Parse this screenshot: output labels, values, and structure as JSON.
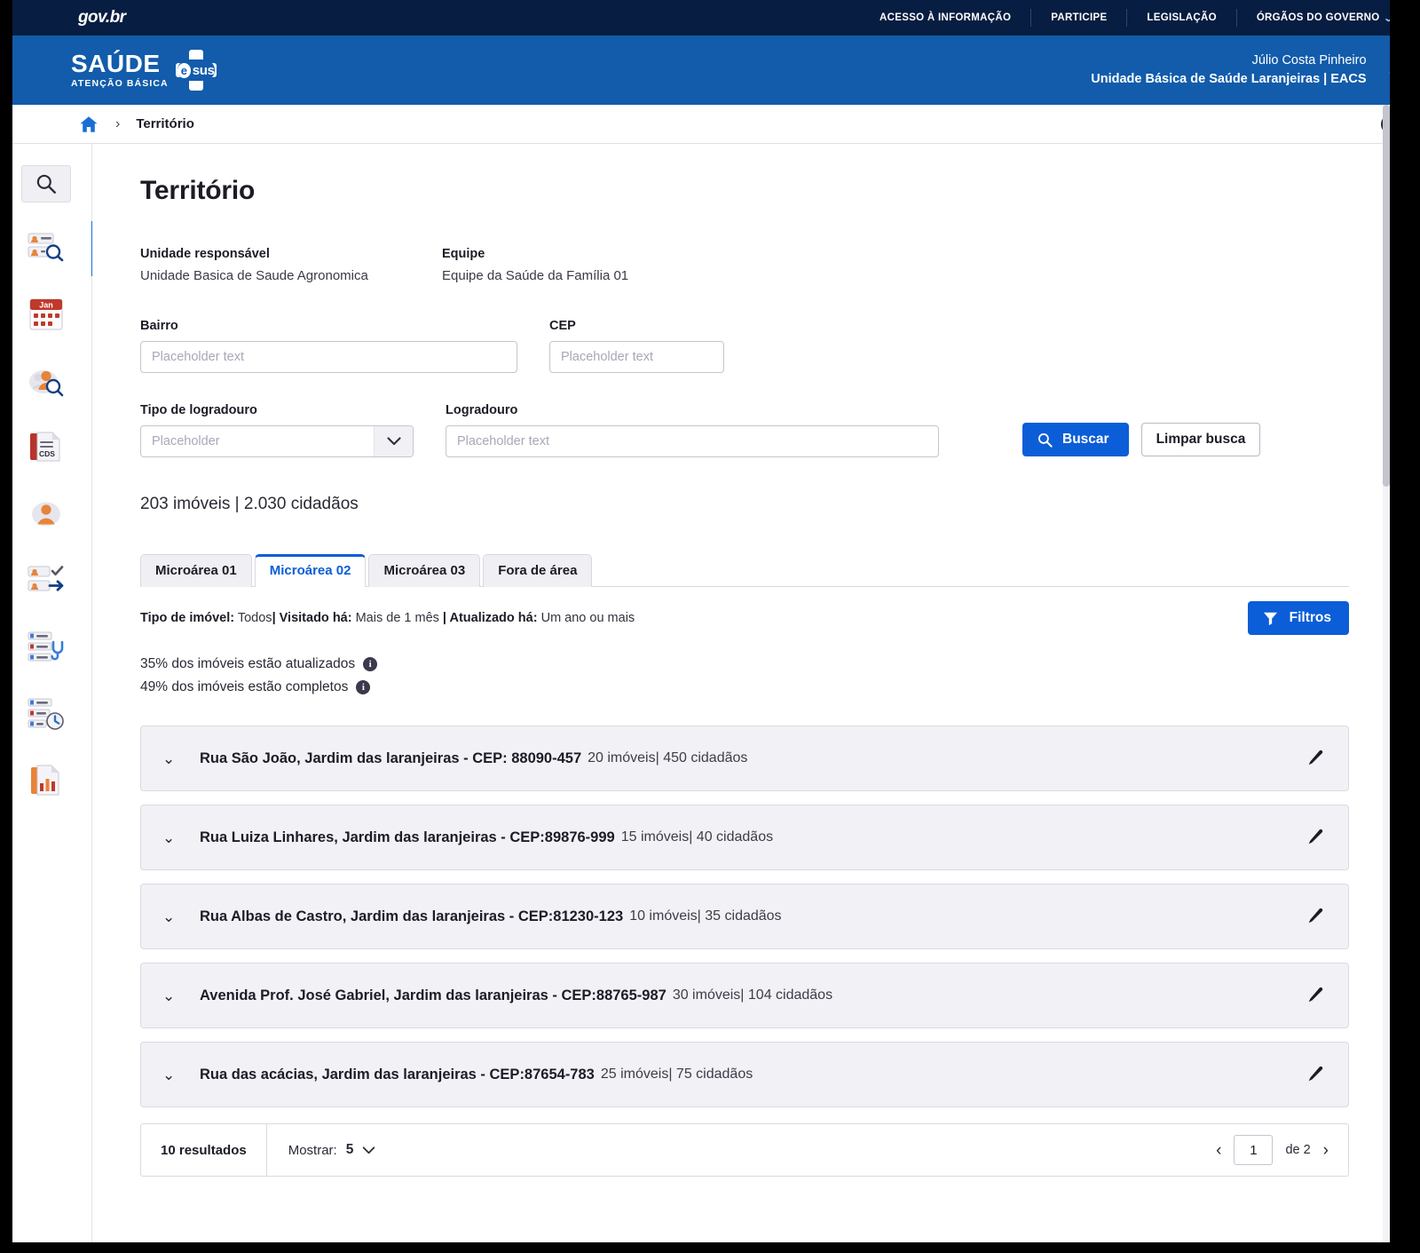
{
  "govbar": {
    "logo": "gov.br",
    "nav": [
      {
        "label": "ACESSO À INFORMAÇÃO"
      },
      {
        "label": "PARTICIPE"
      },
      {
        "label": "LEGISLAÇÃO"
      },
      {
        "label": "ÓRGÃOS DO GOVERNO"
      }
    ]
  },
  "brand": {
    "title": "SAÚDE",
    "subtitle": "ATENÇÃO BÁSICA",
    "esus_e": "e",
    "esus_sus": "sus",
    "user_name": "Júlio Costa Pinheiro",
    "user_unit": "Unidade Básica de Saúde Laranjeiras | EACS"
  },
  "breadcrumb": {
    "home_icon": "home-icon",
    "separator": "›",
    "current": "Território",
    "contrast_icon": "contrast-icon"
  },
  "sidebar": {
    "items": [
      {
        "icon": "search-icon",
        "name": "sidebar-item-search"
      },
      {
        "icon": "citizen-search-icon",
        "name": "sidebar-item-cidadao"
      },
      {
        "icon": "calendar-icon",
        "name": "sidebar-item-agenda",
        "month": "Jan"
      },
      {
        "icon": "group-search-icon",
        "name": "sidebar-item-grupos"
      },
      {
        "icon": "cds-document-icon",
        "name": "sidebar-item-cds",
        "badge": "CDS"
      },
      {
        "icon": "user-avatar-icon",
        "name": "sidebar-item-perfil"
      },
      {
        "icon": "checkin-transfer-icon",
        "name": "sidebar-item-atendimento"
      },
      {
        "icon": "list-stethoscope-icon",
        "name": "sidebar-item-lista-atendimento"
      },
      {
        "icon": "list-clock-icon",
        "name": "sidebar-item-lista-espera"
      },
      {
        "icon": "report-chart-icon",
        "name": "sidebar-item-relatorios"
      }
    ]
  },
  "page": {
    "title": "Território"
  },
  "info": {
    "unit_label": "Unidade responsável",
    "unit_value": "Unidade Basica de Saude Agronomica",
    "team_label": "Equipe",
    "team_value": "Equipe da Saúde da Família 01"
  },
  "form": {
    "bairro_label": "Bairro",
    "bairro_placeholder": "Placeholder text",
    "bairro_value": "",
    "cep_label": "CEP",
    "cep_placeholder": "Placeholder text",
    "cep_value": "",
    "tipo_label": "Tipo de logradouro",
    "tipo_placeholder": "Placeholder",
    "tipo_value": "Placeholder",
    "logradouro_label": "Logradouro",
    "logradouro_placeholder": "Placeholder text",
    "logradouro_value": "",
    "buscar_label": "Buscar",
    "limpar_label": "Limpar busca"
  },
  "counts": {
    "text": "203 imóveis  | 2.030 cidadãos"
  },
  "tabs": [
    {
      "label": "Microárea 01",
      "active": false
    },
    {
      "label": "Microárea 02",
      "active": true
    },
    {
      "label": "Microárea 03",
      "active": false
    },
    {
      "label": "Fora de área",
      "active": false
    }
  ],
  "filters": {
    "tipo_key": "Tipo de imóvel:",
    "tipo_val": " Todos",
    "visitado_key": "| Visitado há:",
    "visitado_val": " Mais de 1 mês ",
    "atualizado_key": "| Atualizado há:",
    "atualizado_val": " Um ano ou mais",
    "button_label": "Filtros",
    "button_icon": "filter-funnel-icon"
  },
  "stats": [
    {
      "text": "35% dos imóveis estão atualizados",
      "info": "i"
    },
    {
      "text": "49% dos imóveis estão completos",
      "info": "i"
    }
  ],
  "streets": [
    {
      "chevron": "⌄",
      "name": "Rua São João, Jardim das laranjeiras - CEP: 88090-457",
      "meta": "20 imóveis| 450 cidadãos",
      "edit_icon": "pencil-icon"
    },
    {
      "chevron": "⌄",
      "name": "Rua Luiza Linhares, Jardim das laranjeiras - CEP:89876-999",
      "meta": "15 imóveis| 40 cidadãos",
      "edit_icon": "pencil-icon"
    },
    {
      "chevron": "⌄",
      "name": "Rua Albas de Castro, Jardim das laranjeiras - CEP:81230-123",
      "meta": "10 imóveis| 35 cidadãos",
      "edit_icon": "pencil-icon"
    },
    {
      "chevron": "⌄",
      "name": "Avenida Prof. José Gabriel, Jardim das laranjeiras - CEP:88765-987",
      "meta": "30 imóveis| 104 cidadãos",
      "edit_icon": "pencil-icon"
    },
    {
      "chevron": "⌄",
      "name": "Rua das acácias, Jardim das laranjeiras - CEP:87654-783",
      "meta": " 25 imóveis| 75 cidadãos",
      "edit_icon": "pencil-icon"
    }
  ],
  "pagination": {
    "results": "10 resultados",
    "show_label": "Mostrar:",
    "show_value": "5",
    "prev_icon": "‹",
    "next_icon": "›",
    "page_value": "1",
    "of_text": "de 2"
  },
  "colors": {
    "govbar_bg": "#071d41",
    "brand_bg": "#125cab",
    "accent": "#0b5ed7",
    "row_bg": "#f1f1f6",
    "text": "#1c1c27"
  }
}
